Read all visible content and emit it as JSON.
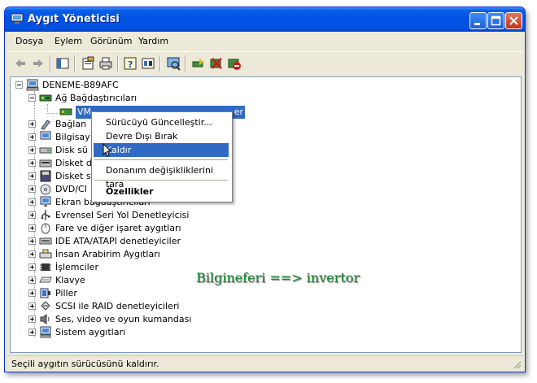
{
  "window": {
    "title": "Aygıt Yöneticisi",
    "title_icon": "device-manager-icon",
    "controls": [
      "minimize-icon",
      "maximize-icon",
      "close-icon"
    ]
  },
  "menu": {
    "items": [
      "Dosya",
      "Eylem",
      "Görünüm",
      "Yardım"
    ]
  },
  "toolbar": {
    "icons": [
      "back-arrow-icon",
      "forward-arrow-icon",
      "show-hide-tree-icon",
      "properties-icon",
      "print-icon",
      "help-icon",
      "view-details-icon",
      "scan-hardware-icon",
      "update-driver-icon",
      "uninstall-icon",
      "disable-icon"
    ]
  },
  "tree": {
    "root": "DENEME-B89AFC",
    "category_expanded": "Ağ Bağdaştırıcıları",
    "selected_child": "VM",
    "selected_child_tail": "er",
    "partial_categories": [
      "Bağlan",
      "Bilgisay",
      "Disk sü",
      "Disket d",
      "Disket s",
      "DVD/CI"
    ],
    "categories": [
      "Ekran bağdaştırıcıları",
      "Evrensel Seri Yol Denetleyicisi",
      "Fare ve diğer işaret aygıtları",
      "IDE ATA/ATAPI denetleyiciler",
      "İnsan Arabirim Aygıtları",
      "İşlemciler",
      "Klavye",
      "Piller",
      "SCSI ile RAID denetleyicileri",
      "Ses, video ve oyun kumandası",
      "Sistem aygıtları"
    ]
  },
  "context_menu": {
    "update_driver": "Sürücüyü Güncelleştir...",
    "disable": "Devre Dışı Bırak",
    "uninstall": "Kaldır",
    "scan": "Donanım değişikliklerini tara",
    "properties": "Özellikler"
  },
  "watermark": "Bilgineferi  ==> invertor",
  "status": "Seçili aygıtın sürücüsünü kaldırır.",
  "colors": {
    "titlebar": "#0054e3",
    "selection": "#316ac5",
    "watermark": "#178a2e"
  }
}
